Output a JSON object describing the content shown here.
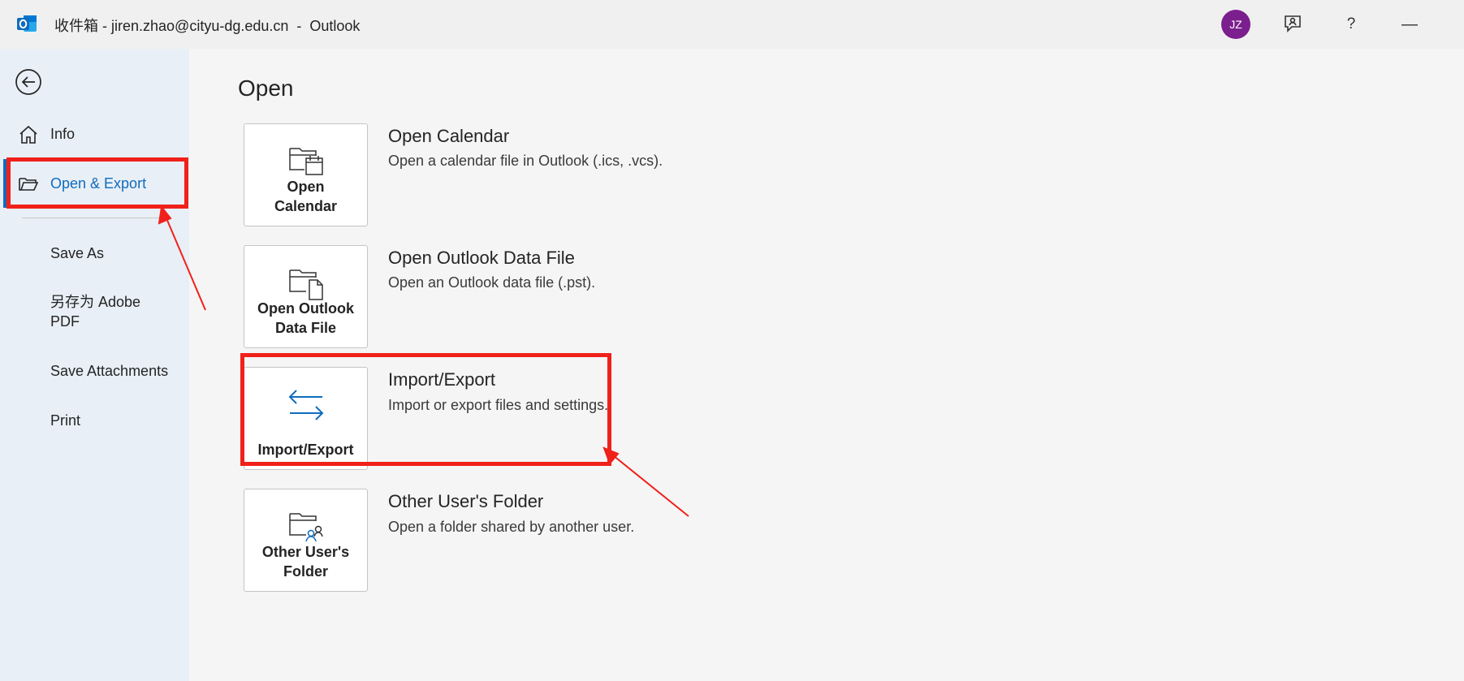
{
  "window": {
    "title": "收件箱 - jiren.zhao@cityu-dg.edu.cn  -  Outlook",
    "avatar_initials": "JZ",
    "accent_color": "#0f6cbd",
    "avatar_color": "#7b1e8e"
  },
  "titlebar": {
    "help_label": "?",
    "minimize_label": "—"
  },
  "sidebar": {
    "items": [
      {
        "label": "Info",
        "icon": "home-icon"
      },
      {
        "label": "Open & Export",
        "icon": "folder-open-icon",
        "selected": true
      },
      {
        "label": "Save As"
      },
      {
        "label": "另存为 Adobe PDF"
      },
      {
        "label": "Save Attachments"
      },
      {
        "label": "Print"
      }
    ]
  },
  "main": {
    "section_title": "Open",
    "options": [
      {
        "tile_label": "Open\nCalendar",
        "title": "Open Calendar",
        "description": "Open a calendar file in Outlook (.ics, .vcs).",
        "icon": "calendar-folder-icon"
      },
      {
        "tile_label": "Open Outlook\nData File",
        "title": "Open Outlook Data File",
        "description": "Open an Outlook data file (.pst).",
        "icon": "data-file-folder-icon"
      },
      {
        "tile_label": "Import/Export",
        "title": "Import/Export",
        "description": "Import or export files and settings.",
        "icon": "import-export-arrows-icon"
      },
      {
        "tile_label": "Other User's\nFolder",
        "title": "Other User's Folder",
        "description": "Open a folder shared by another user.",
        "icon": "shared-folder-icon"
      }
    ]
  },
  "annotations": {
    "color": "#f0211a"
  }
}
